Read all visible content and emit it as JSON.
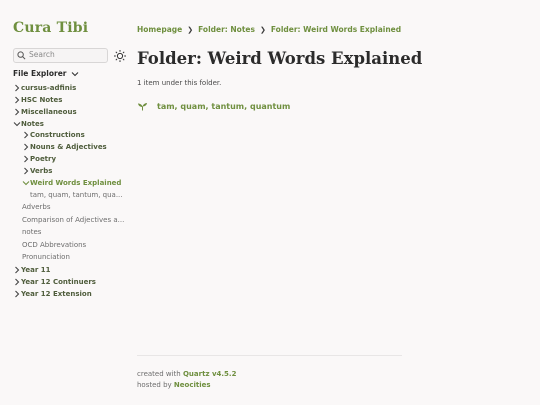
{
  "site_title": "Cura Tibi",
  "search": {
    "placeholder": "Search"
  },
  "explorer": {
    "title": "File Explorer",
    "items": [
      {
        "label": "cursus-adfinis",
        "type": "folder",
        "state": "closed"
      },
      {
        "label": "HSC Notes",
        "type": "folder",
        "state": "closed"
      },
      {
        "label": "Miscellaneous",
        "type": "folder",
        "state": "closed"
      },
      {
        "label": "Notes",
        "type": "folder",
        "state": "open"
      },
      {
        "label": "Constructions",
        "type": "folder",
        "state": "closed"
      },
      {
        "label": "Nouns & Adjectives",
        "type": "folder",
        "state": "closed"
      },
      {
        "label": "Poetry",
        "type": "folder",
        "state": "closed"
      },
      {
        "label": "Verbs",
        "type": "folder",
        "state": "closed"
      },
      {
        "label": "Weird Words Explained",
        "type": "folder",
        "state": "open-active"
      },
      {
        "label": "tam, quam, tantum, qua...",
        "type": "file"
      },
      {
        "label": "Adverbs",
        "type": "file"
      },
      {
        "label": "Comparison of Adjectives a...",
        "type": "file"
      },
      {
        "label": "notes",
        "type": "file"
      },
      {
        "label": "OCD Abbrevations",
        "type": "file"
      },
      {
        "label": "Pronunciation",
        "type": "file"
      },
      {
        "label": "Year 11",
        "type": "folder",
        "state": "closed"
      },
      {
        "label": "Year 12 Continuers",
        "type": "folder",
        "state": "closed"
      },
      {
        "label": "Year 12 Extension",
        "type": "folder",
        "state": "closed"
      }
    ]
  },
  "breadcrumb": [
    "Homepage",
    "Folder: Notes",
    "Folder: Weird Words Explained"
  ],
  "breadcrumb_separator": "❯",
  "page": {
    "title": "Folder: Weird Words Explained",
    "count_text": "1 item under this folder.",
    "listing": [
      {
        "icon": "seedling-icon",
        "label": "tam, quam, tantum, quantum"
      }
    ]
  },
  "footer": {
    "created_prefix": "created with",
    "created_link": "Quartz v4.5.2",
    "hosted_prefix": "hosted by",
    "hosted_link": "Neocities"
  },
  "colors": {
    "accent": "#6f8f3f",
    "background": "#faf8f8",
    "text": "#3a3a3a"
  }
}
